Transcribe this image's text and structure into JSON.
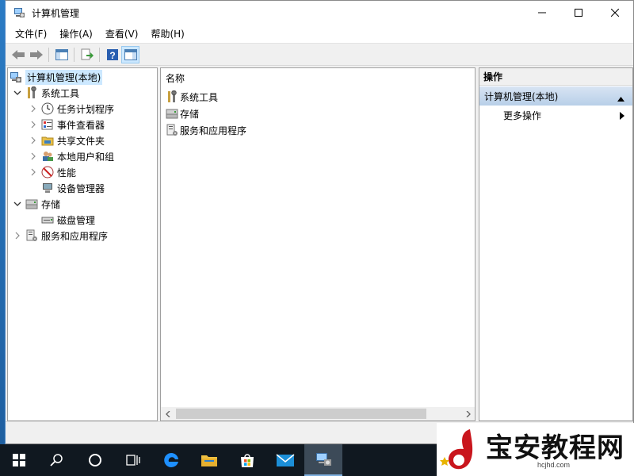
{
  "window": {
    "title": "计算机管理"
  },
  "menu": [
    "文件(F)",
    "操作(A)",
    "查看(V)",
    "帮助(H)"
  ],
  "tree": {
    "root": "计算机管理(本地)",
    "system_tools": "系统工具",
    "task_scheduler": "任务计划程序",
    "event_viewer": "事件查看器",
    "shared_folders": "共享文件夹",
    "local_users": "本地用户和组",
    "performance": "性能",
    "device_manager": "设备管理器",
    "storage": "存储",
    "disk_management": "磁盘管理",
    "services": "服务和应用程序"
  },
  "list": {
    "header": "名称",
    "items": [
      "系统工具",
      "存储",
      "服务和应用程序"
    ]
  },
  "actions": {
    "header": "操作",
    "group": "计算机管理(本地)",
    "more": "更多操作"
  },
  "watermark": {
    "text": "宝安教程网",
    "url": "hcjhd.com"
  },
  "colors": {
    "selection": "#cce8ff",
    "taskbar": "#101820",
    "accent": "#0078d7"
  }
}
